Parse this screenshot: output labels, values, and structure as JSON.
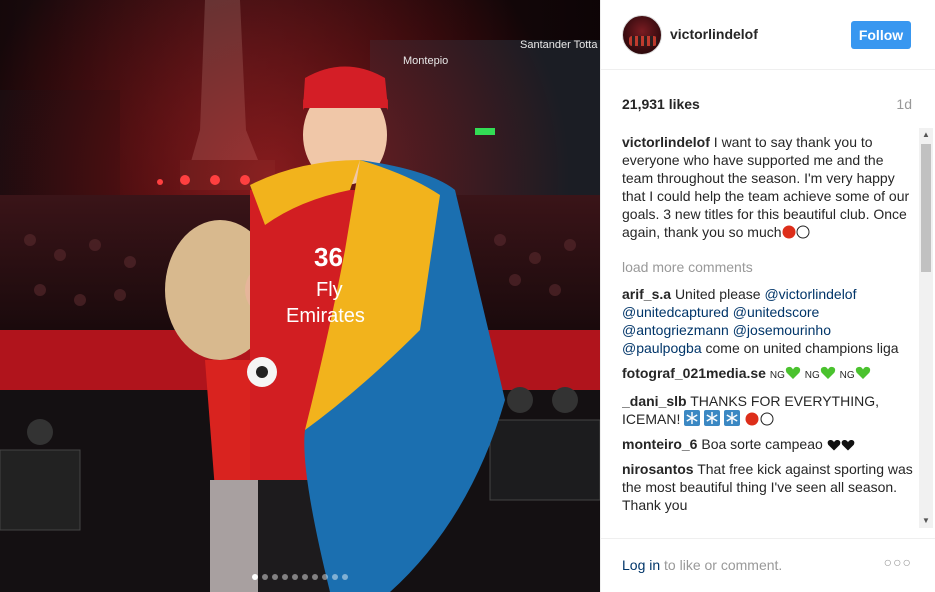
{
  "post": {
    "username": "victorlindelof",
    "follow_label": "Follow",
    "likes": "21,931 likes",
    "age": "1d",
    "load_more": "load more comments",
    "carousel": {
      "count": 10,
      "active_index": 0
    },
    "colors": {
      "accent": "#3897f0",
      "link": "#003569",
      "muted": "#999999"
    }
  },
  "photo": {
    "signs": [
      "Montepio",
      "Santander Totta"
    ],
    "jersey": {
      "number": "36",
      "sponsor_line1": "Fly",
      "sponsor_line2": "Emirates"
    }
  },
  "comments": [
    {
      "user": "victorlindelof",
      "text": "I want to say thank you to everyone who have supported me and the team throughout the season. I'm very happy that I could help the team achieve some of our goals. 3 new titles for this beautiful club. Once again, thank you so much",
      "emoji": [
        "red-circle",
        "white-circle"
      ]
    },
    {
      "user": "arif_s.a",
      "text_parts": [
        "United please ",
        "@victorlindelof",
        " ",
        "@unitedcaptured",
        " ",
        "@unitedscore",
        " ",
        "@antogriezmann",
        " ",
        "@josemourinho",
        " ",
        "@paulpogba",
        " come on united champions liga"
      ]
    },
    {
      "user": "fotograf_021media.se",
      "tokens": [
        "NG",
        "NG",
        "NG"
      ]
    },
    {
      "user": "_dani_slb",
      "text": "THANKS FOR EVERYTHING, ICEMAN!",
      "emoji": [
        "snowflake",
        "snowflake",
        "snowflake",
        "red-circle",
        "white-circle"
      ]
    },
    {
      "user": "monteiro_6",
      "text": "Boa sorte campeao",
      "emoji": [
        "black-heart",
        "black-heart"
      ]
    },
    {
      "user": "nirosantos",
      "text": "That free kick against sporting was the most beautiful thing I've seen all season. Thank you"
    }
  ],
  "footer": {
    "login_link": "Log in",
    "login_rest": " to like or comment.",
    "more_icon": "more-options-icon"
  }
}
